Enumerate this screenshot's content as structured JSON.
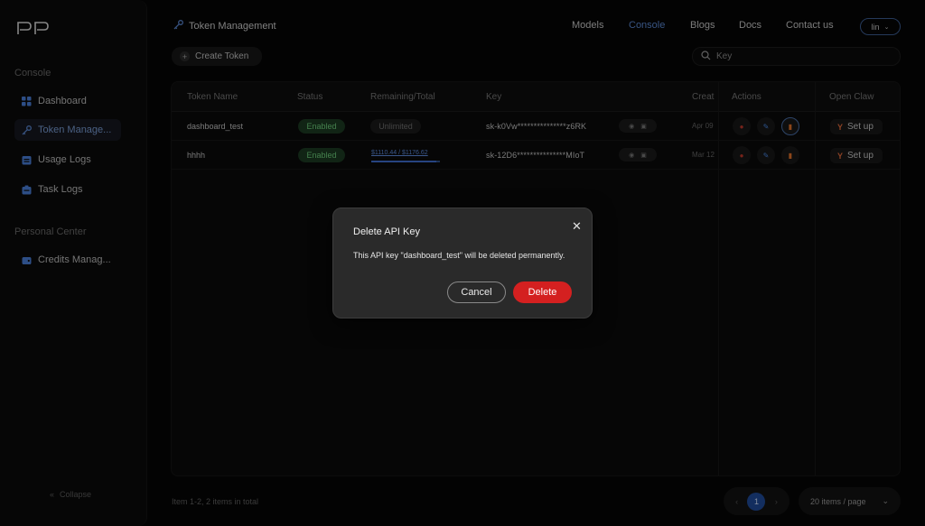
{
  "sidebar": {
    "logo": "PP",
    "console_title": "Console",
    "items": [
      {
        "label": "Dashboard",
        "icon": "grid-icon"
      },
      {
        "label": "Token Manage...",
        "icon": "key-icon"
      },
      {
        "label": "Usage Logs",
        "icon": "log-icon"
      },
      {
        "label": "Task Logs",
        "icon": "task-icon"
      }
    ],
    "personal_title": "Personal Center",
    "personal_items": [
      {
        "label": "Credits Manag...",
        "icon": "wallet-icon"
      }
    ],
    "collapse": "Collapse"
  },
  "header": {
    "title": "Token Management",
    "nav": [
      "Models",
      "Console",
      "Blogs",
      "Docs",
      "Contact us"
    ],
    "active_nav": "Console",
    "user": "lin"
  },
  "toolbar": {
    "create_label": "Create Token",
    "search_placeholder": "Key"
  },
  "table": {
    "columns": [
      "Token Name",
      "Status",
      "Remaining/Total",
      "Key",
      "Creat",
      "Actions",
      "Open Claw"
    ],
    "rows": [
      {
        "name": "dashboard_test",
        "status": "Enabled",
        "remaining": "Unlimited",
        "remaining_fraction": null,
        "key": "sk-k0Vw***************z6RK",
        "created": "Apr 09",
        "setup": "Set up"
      },
      {
        "name": "hhhh",
        "status": "Enabled",
        "remaining": "$1110.44 / $1176.62",
        "remaining_fraction": 0.944,
        "key": "sk-12D6***************MIoT",
        "created": "Mar 12",
        "setup": "Set up"
      }
    ]
  },
  "footer": {
    "total": "Item 1-2, 2 items in total",
    "page": "1",
    "per_page": "20 items / page"
  },
  "modal": {
    "title": "Delete API Key",
    "body": "This API key \"dashboard_test\" will be deleted permanently.",
    "cancel": "Cancel",
    "delete": "Delete"
  },
  "colors": {
    "accent": "#5b89d4",
    "danger": "#d42020",
    "enabled_bg": "#1c3a22",
    "enabled_fg": "#6ed07d"
  }
}
